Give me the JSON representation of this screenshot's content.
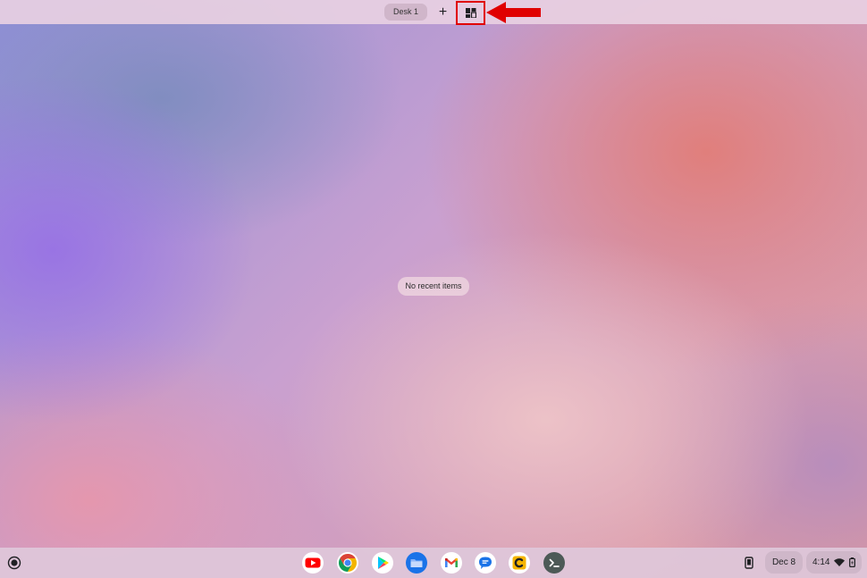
{
  "desk_bar": {
    "desk_name": "Desk 1",
    "new_desk_icon": "+",
    "templates_icon": "desk-templates-icon"
  },
  "main": {
    "empty_message": "No recent items"
  },
  "shelf": {
    "apps": [
      {
        "name": "YouTube",
        "icon": "youtube-icon"
      },
      {
        "name": "Chrome",
        "icon": "chrome-icon"
      },
      {
        "name": "Play Store",
        "icon": "play-store-icon"
      },
      {
        "name": "Files",
        "icon": "files-icon"
      },
      {
        "name": "Gmail",
        "icon": "gmail-icon"
      },
      {
        "name": "Messages",
        "icon": "messages-icon"
      },
      {
        "name": "Caret",
        "icon": "caret-icon"
      },
      {
        "name": "Terminal",
        "icon": "terminal-icon"
      }
    ],
    "tray": {
      "date": "Dec 8",
      "time": "4:14"
    }
  },
  "colors": {
    "highlight": "#e00000",
    "arrow": "#e00000"
  }
}
